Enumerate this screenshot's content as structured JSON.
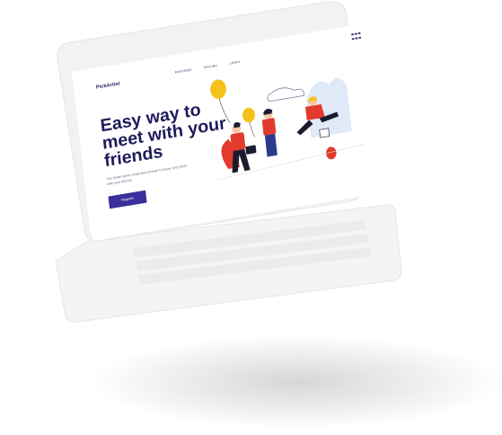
{
  "brand": "PickArtist",
  "nav": {
    "links": [
      "FEATURES",
      "PRICING",
      "LOGIN"
    ]
  },
  "hero": {
    "title": "Easy way to meet with your friends",
    "subtitle": "You mean some email and provide to know, and meet with your friends.",
    "cta_label": "Register"
  },
  "colors": {
    "primary": "#3a2f9c",
    "heading": "#1f1b5a",
    "accent_red": "#e23a2e",
    "accent_yellow": "#f5c21b",
    "laptop": "#f2f2f2"
  },
  "icons": [
    "menu-grid-icon"
  ]
}
